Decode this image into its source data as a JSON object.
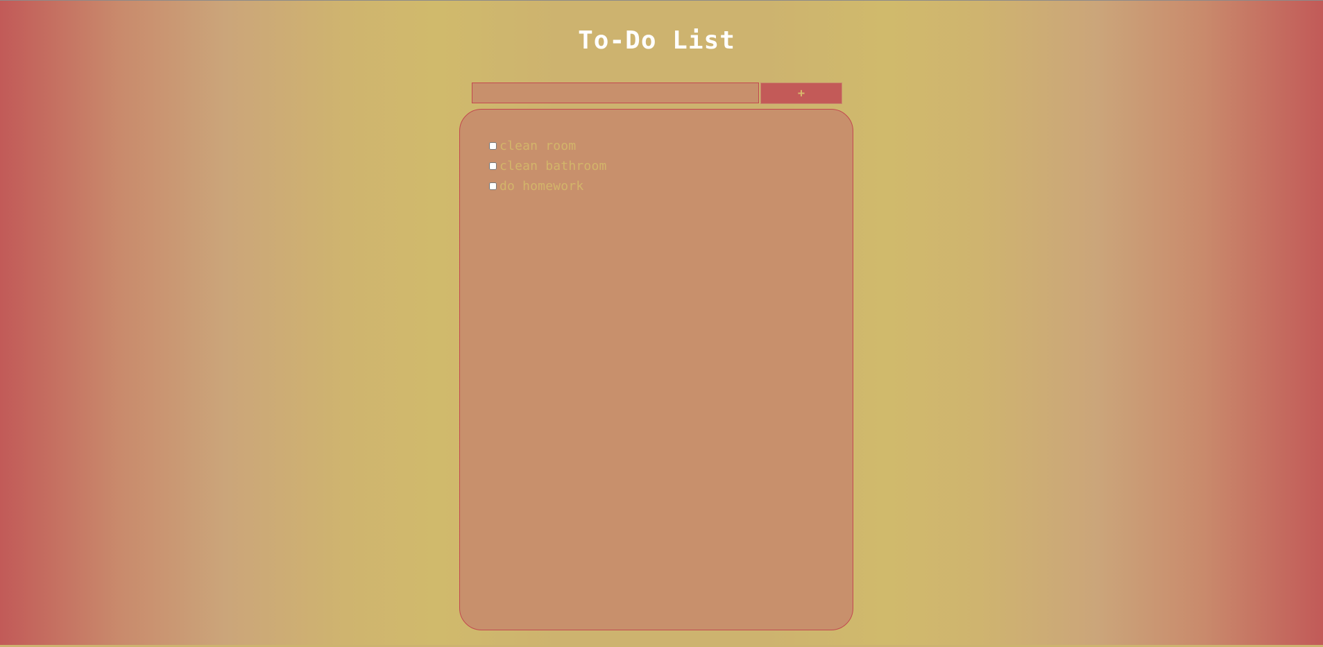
{
  "page": {
    "title": "To-Do List"
  },
  "add_form": {
    "input_value": "",
    "input_placeholder": "",
    "add_button_label": "+"
  },
  "todos": [
    {
      "text": "clean room",
      "checked": false
    },
    {
      "text": "clean bathroom",
      "checked": false
    },
    {
      "text": "do homework",
      "checked": false
    }
  ],
  "colors": {
    "accent": "#c35a58",
    "panel_background": "#c8906c",
    "item_text": "#d3b56a",
    "title_text": "#ffffff"
  }
}
